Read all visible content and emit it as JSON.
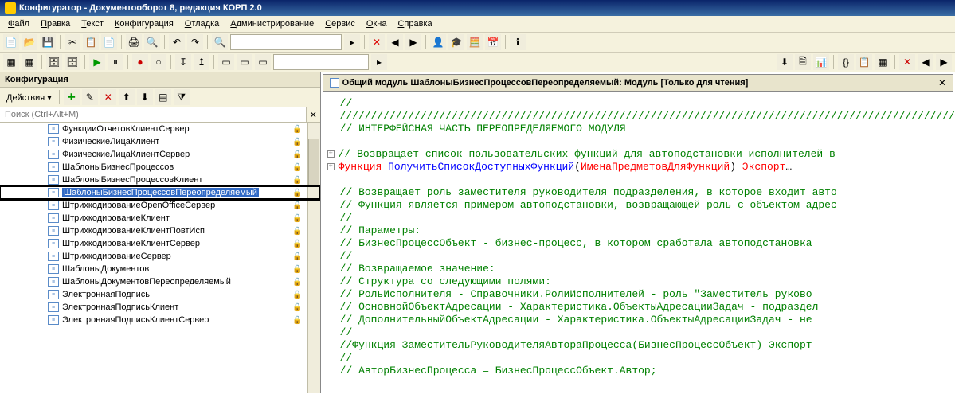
{
  "title": "Конфигуратор - Документооборот 8, редакция КОРП 2.0",
  "menu": [
    "Файл",
    "Правка",
    "Текст",
    "Конфигурация",
    "Отладка",
    "Администрирование",
    "Сервис",
    "Окна",
    "Справка"
  ],
  "leftpanel": {
    "title": "Конфигурация",
    "actions_label": "Действия ▾",
    "search_placeholder": "Поиск (Ctrl+Alt+M)",
    "items": [
      {
        "label": "ФункцииОтчетовКлиентСервер",
        "locked": true
      },
      {
        "label": "ФизическиеЛицаКлиент",
        "locked": true
      },
      {
        "label": "ФизическиеЛицаКлиентСервер",
        "locked": true
      },
      {
        "label": "ШаблоныБизнесПроцессов",
        "locked": true
      },
      {
        "label": "ШаблоныБизнесПроцессовКлиент",
        "locked": true
      },
      {
        "label": "ШаблоныБизнесПроцессовПереопределяемый",
        "locked": true,
        "selected": true,
        "boxed": true
      },
      {
        "label": "ШтрихкодированиеOpenOfficeСервер",
        "locked": true
      },
      {
        "label": "ШтрихкодированиеКлиент",
        "locked": true
      },
      {
        "label": "ШтрихкодированиеКлиентПовтИсп",
        "locked": true
      },
      {
        "label": "ШтрихкодированиеКлиентСервер",
        "locked": true
      },
      {
        "label": "ШтрихкодированиеСервер",
        "locked": true
      },
      {
        "label": "ШаблоныДокументов",
        "locked": true
      },
      {
        "label": "ШаблоныДокументовПереопределяемый",
        "locked": true
      },
      {
        "label": "ЭлектроннаяПодпись",
        "locked": true
      },
      {
        "label": "ЭлектроннаяПодписьКлиент",
        "locked": true
      },
      {
        "label": "ЭлектроннаяПодписьКлиентСервер",
        "locked": true
      }
    ]
  },
  "editor": {
    "tab_title": "Общий модуль ШаблоныБизнесПроцессовПереопределяемый: Модуль [Только для чтения]",
    "lines": [
      {
        "g": "",
        "spans": [
          {
            "t": "//",
            "c": "green"
          }
        ]
      },
      {
        "g": "",
        "spans": [
          {
            "t": "///////////////////////////////////////////////////////////////////////////////////////////////////",
            "c": "green"
          }
        ]
      },
      {
        "g": "",
        "spans": [
          {
            "t": "// ИНТЕРФЕЙСНАЯ ЧАСТЬ ПЕРЕОПРЕДЕЛЯЕМОГО МОДУЛЯ",
            "c": "green"
          }
        ]
      },
      {
        "g": "",
        "spans": []
      },
      {
        "g": "+",
        "spans": [
          {
            "t": "// Возвращает список пользовательских функций для автоподстановки исполнителей в",
            "c": "green"
          }
        ]
      },
      {
        "g": "+",
        "spans": [
          {
            "t": "Функция ",
            "c": "red"
          },
          {
            "t": "ПолучитьСписокДоступныхФункций",
            "c": "blue"
          },
          {
            "t": "(",
            "c": "black"
          },
          {
            "t": "ИменаПредметовДляФункций",
            "c": "red"
          },
          {
            "t": ")  ",
            "c": "black"
          },
          {
            "t": "Экспорт",
            "c": "red"
          },
          {
            "t": "…",
            "c": "black"
          }
        ]
      },
      {
        "g": "",
        "spans": []
      },
      {
        "g": "",
        "spans": [
          {
            "t": "// Возвращает роль заместителя руководителя подразделения, в которое входит авто",
            "c": "green"
          }
        ]
      },
      {
        "g": "",
        "spans": [
          {
            "t": "// Функция является примером автоподстановки, возвращающей роль с объектом адрес",
            "c": "green"
          }
        ]
      },
      {
        "g": "",
        "spans": [
          {
            "t": "//",
            "c": "green"
          }
        ]
      },
      {
        "g": "",
        "spans": [
          {
            "t": "// Параметры:",
            "c": "green"
          }
        ]
      },
      {
        "g": "",
        "spans": [
          {
            "t": "//   БизнесПроцессОбъект - бизнес-процесс, в котором сработала автоподстановка ",
            "c": "green"
          }
        ]
      },
      {
        "g": "",
        "spans": [
          {
            "t": "//",
            "c": "green"
          }
        ]
      },
      {
        "g": "",
        "spans": [
          {
            "t": "// Возвращаемое значение:",
            "c": "green"
          }
        ]
      },
      {
        "g": "",
        "spans": [
          {
            "t": "//   Структура со следующими полями:",
            "c": "green"
          }
        ]
      },
      {
        "g": "",
        "spans": [
          {
            "t": "//     РольИсполнителя - Справочники.РолиИсполнителей - роль \"Заместитель руково",
            "c": "green"
          }
        ]
      },
      {
        "g": "",
        "spans": [
          {
            "t": "//     ОсновнойОбъектАдресации - Характеристика.ОбъектыАдресацииЗадач - подраздел",
            "c": "green"
          }
        ]
      },
      {
        "g": "",
        "spans": [
          {
            "t": "//     ДополнительныйОбъектАдресации - Характеристика.ОбъектыАдресацииЗадач - не",
            "c": "green"
          }
        ]
      },
      {
        "g": "",
        "spans": [
          {
            "t": "//",
            "c": "green"
          }
        ]
      },
      {
        "g": "",
        "spans": [
          {
            "t": "//Функция ЗаместительРуководителяАвтораПроцесса(БизнесПроцессОбъект) Экспорт",
            "c": "green"
          }
        ]
      },
      {
        "g": "",
        "spans": [
          {
            "t": "//",
            "c": "green"
          }
        ]
      },
      {
        "g": "",
        "spans": [
          {
            "t": "//  АвторБизнесПроцесса = БизнесПроцессОбъект.Автор;",
            "c": "green"
          }
        ]
      }
    ]
  }
}
